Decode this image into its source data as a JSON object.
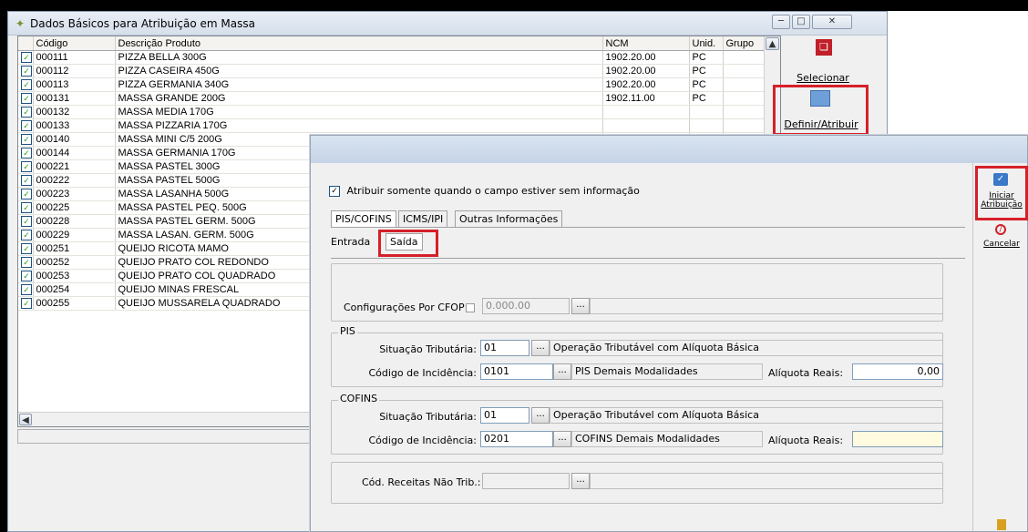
{
  "back_window": {
    "title": "Dados Básicos para Atribuição em Massa",
    "columns": [
      "Código",
      "Descrição Produto",
      "NCM",
      "Unid.",
      "Grupo"
    ],
    "rows": [
      {
        "codigo": "000111",
        "descricao": "PIZZA BELLA 300G",
        "ncm": "1902.20.00",
        "unid": "PC"
      },
      {
        "codigo": "000112",
        "descricao": "PIZZA CASEIRA 450G",
        "ncm": "1902.20.00",
        "unid": "PC"
      },
      {
        "codigo": "000113",
        "descricao": "PIZZA GERMANIA 340G",
        "ncm": "1902.20.00",
        "unid": "PC"
      },
      {
        "codigo": "000131",
        "descricao": "MASSA GRANDE 200G",
        "ncm": "1902.11.00",
        "unid": "PC"
      },
      {
        "codigo": "000132",
        "descricao": "MASSA MEDIA 170G",
        "ncm": "",
        "unid": ""
      },
      {
        "codigo": "000133",
        "descricao": "MASSA PIZZARIA 170G",
        "ncm": "",
        "unid": ""
      },
      {
        "codigo": "000140",
        "descricao": "MASSA MINI C/5 200G",
        "ncm": "",
        "unid": ""
      },
      {
        "codigo": "000144",
        "descricao": "MASSA GERMANIA 170G",
        "ncm": "",
        "unid": ""
      },
      {
        "codigo": "000221",
        "descricao": "MASSA PASTEL 300G",
        "ncm": "",
        "unid": ""
      },
      {
        "codigo": "000222",
        "descricao": "MASSA PASTEL 500G",
        "ncm": "",
        "unid": ""
      },
      {
        "codigo": "000223",
        "descricao": "MASSA LASANHA 500G",
        "ncm": "",
        "unid": ""
      },
      {
        "codigo": "000225",
        "descricao": "MASSA PASTEL PEQ. 500G",
        "ncm": "",
        "unid": ""
      },
      {
        "codigo": "000228",
        "descricao": "MASSA PASTEL GERM. 500G",
        "ncm": "",
        "unid": ""
      },
      {
        "codigo": "000229",
        "descricao": "MASSA LASAN. GERM. 500G",
        "ncm": "",
        "unid": ""
      },
      {
        "codigo": "000251",
        "descricao": "QUEIJO RICOTA MAMO",
        "ncm": "",
        "unid": ""
      },
      {
        "codigo": "000252",
        "descricao": "QUEIJO PRATO COL REDONDO",
        "ncm": "",
        "unid": ""
      },
      {
        "codigo": "000253",
        "descricao": "QUEIJO PRATO COL QUADRADO",
        "ncm": "",
        "unid": ""
      },
      {
        "codigo": "000254",
        "descricao": "QUEIJO MINAS FRESCAL",
        "ncm": "",
        "unid": ""
      },
      {
        "codigo": "000255",
        "descricao": "QUEIJO MUSSARELA QUADRADO",
        "ncm": "",
        "unid": ""
      }
    ],
    "buttons": {
      "selecionar": "Selecionar",
      "definir": "Definir/Atribuir"
    }
  },
  "dialog": {
    "checkbox_label": "Atribuir somente quando o campo estiver sem informação",
    "tabs": [
      "PIS/COFINS",
      "ICMS/IPI",
      "Outras Informações"
    ],
    "subtabs": [
      "Entrada",
      "Saída"
    ],
    "cfop": {
      "label": "Configurações Por CFOP:",
      "value": "0.000.00"
    },
    "pis": {
      "group": "PIS",
      "sit_label": "Situação Tributária:",
      "sit_value": "01",
      "sit_desc": "Operação Tributável com Alíquota Básica",
      "inc_label": "Código de Incidência:",
      "inc_value": "0101",
      "inc_desc": "PIS Demais Modalidades",
      "aliq_label": "Alíquota Reais:",
      "aliq_value": "0,00"
    },
    "cofins": {
      "group": "COFINS",
      "sit_label": "Situação Tributária:",
      "sit_value": "01",
      "sit_desc": "Operação Tributável com Alíquota Básica",
      "inc_label": "Código de Incidência:",
      "inc_value": "0201",
      "inc_desc": "COFINS Demais Modalidades",
      "aliq_label": "Alíquota Reais:",
      "aliq_value": ""
    },
    "receitas": {
      "label": "Cód. Receitas Não Trib.:"
    },
    "dots": "...",
    "side": {
      "iniciar": "Iniciar Atribuição",
      "cancelar": "Cancelar"
    }
  },
  "colors": {
    "highlight": "#d62029"
  }
}
